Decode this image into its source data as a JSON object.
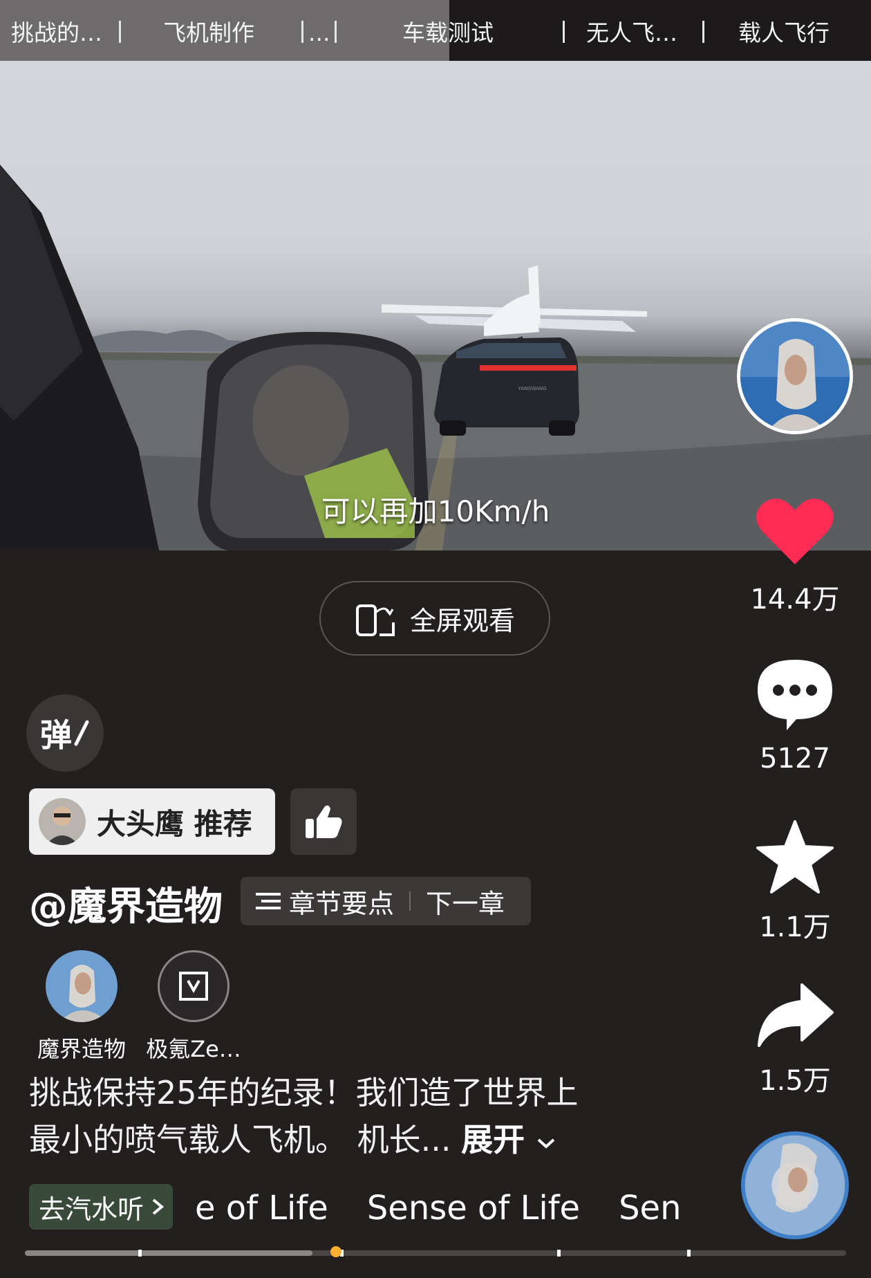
{
  "chapter_bar": {
    "chapters": [
      "挑战的…",
      "飞机制作",
      "...",
      "车载测试",
      "无人飞…",
      "载人飞行"
    ]
  },
  "video": {
    "subtitle": "可以再加10Km/h",
    "fullscreen_label": "全屏观看",
    "car_badge": "YANGWANG"
  },
  "side_rail": {
    "likes": "14.4万",
    "comments": "5127",
    "favorites": "1.1万",
    "shares": "1.5万",
    "colors": {
      "heart": "#fe2c55"
    }
  },
  "danmu_label": "弹",
  "recommend": {
    "label": "大头鹰 推荐"
  },
  "author": {
    "handle": "@魔界造物"
  },
  "chapter_pill": {
    "points_label": "章节要点",
    "next_label": "下一章"
  },
  "collaborators": [
    {
      "name": "魔界造物"
    },
    {
      "name": "极氪Ze…"
    }
  ],
  "description": {
    "line1": "挑战保持25年的纪录！我们造了世界上",
    "line2": "最小的喷气载人飞机。 机长...",
    "expand_label": "展开"
  },
  "music": {
    "badge_label": "去汽水听",
    "marquee": [
      "e of Life",
      "Sense of Life",
      "Sen"
    ]
  },
  "progress": {
    "played_fraction": 0.35
  }
}
